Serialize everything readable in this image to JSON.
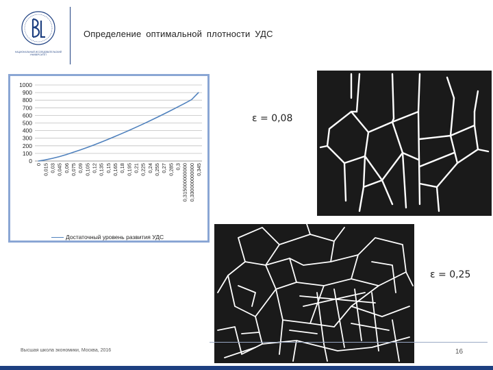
{
  "header": {
    "title": "Определение  оптимальной  плотности  УДС",
    "logo_text": "НАЦИОНАЛЬНЫЙ ИССЛЕДОВАТЕЛЬСКИЙ УНИВЕРСИТЕТ"
  },
  "labels": {
    "eps_1": "ε  = 0,08",
    "eps_2": "ε  = 0,25"
  },
  "footer": {
    "text": "Высшая школа экономики, Москва, 2016",
    "page_number": "16"
  },
  "colors": {
    "brand": "#1d3f80",
    "chart_border": "#8aa6d4",
    "series_line": "#4f81bd",
    "map_background": "#1a1a1a"
  },
  "chart_data": {
    "type": "line",
    "title": "",
    "xlabel": "",
    "ylabel": "",
    "ylim": [
      0,
      1000
    ],
    "yticks": [
      "0",
      "100",
      "200",
      "300",
      "400",
      "500",
      "600",
      "700",
      "800",
      "900",
      "1000"
    ],
    "grid": true,
    "legend_position": "bottom",
    "categories": [
      "0",
      "0,015",
      "0,03",
      "0,045",
      "0,06",
      "0,075",
      "0,09",
      "0,105",
      "0,12",
      "0,135",
      "0,15",
      "0,165",
      "0,18",
      "0,195",
      "0,21",
      "0,225",
      "0,24",
      "0,255",
      "0,27",
      "0,285",
      "0,3",
      "0,315000000000",
      "0,330000000000",
      "0,345"
    ],
    "series": [
      {
        "name": "Достаточный уровень развития УДС",
        "values": [
          0,
          15,
          35,
          58,
          85,
          115,
          145,
          178,
          212,
          248,
          285,
          323,
          362,
          402,
          443,
          485,
          528,
          572,
          617,
          663,
          710,
          758,
          807,
          900
        ]
      }
    ]
  }
}
